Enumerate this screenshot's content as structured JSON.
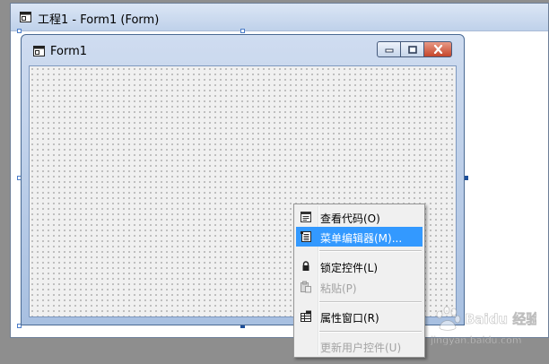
{
  "outer_window": {
    "title": "工程1 - Form1 (Form)",
    "icon": "form-icon"
  },
  "form_window": {
    "title": "Form1",
    "icon": "form-icon",
    "buttons": {
      "minimize": "minimize-icon",
      "maximize": "maximize-icon",
      "close": "close-icon"
    }
  },
  "context_menu": {
    "items": [
      {
        "label": "查看代码(O)",
        "icon": "view-code-icon",
        "state": "normal"
      },
      {
        "label": "菜单编辑器(M)...",
        "icon": "menu-editor-icon",
        "state": "highlighted"
      },
      {
        "label": "锁定控件(L)",
        "icon": "lock-icon",
        "state": "normal"
      },
      {
        "label": "粘贴(P)",
        "icon": "paste-icon",
        "state": "disabled"
      },
      {
        "label": "属性窗口(R)",
        "icon": "properties-icon",
        "state": "normal"
      },
      {
        "label": "更新用户控件(U)",
        "icon": "",
        "state": "disabled"
      }
    ]
  },
  "watermark": {
    "text": "Baidu 经验",
    "url": "jingyan.baidu.com"
  },
  "colors": {
    "highlight": "#3399ff",
    "titlebar": "#bfd1ea",
    "close_button": "#c5452b"
  }
}
